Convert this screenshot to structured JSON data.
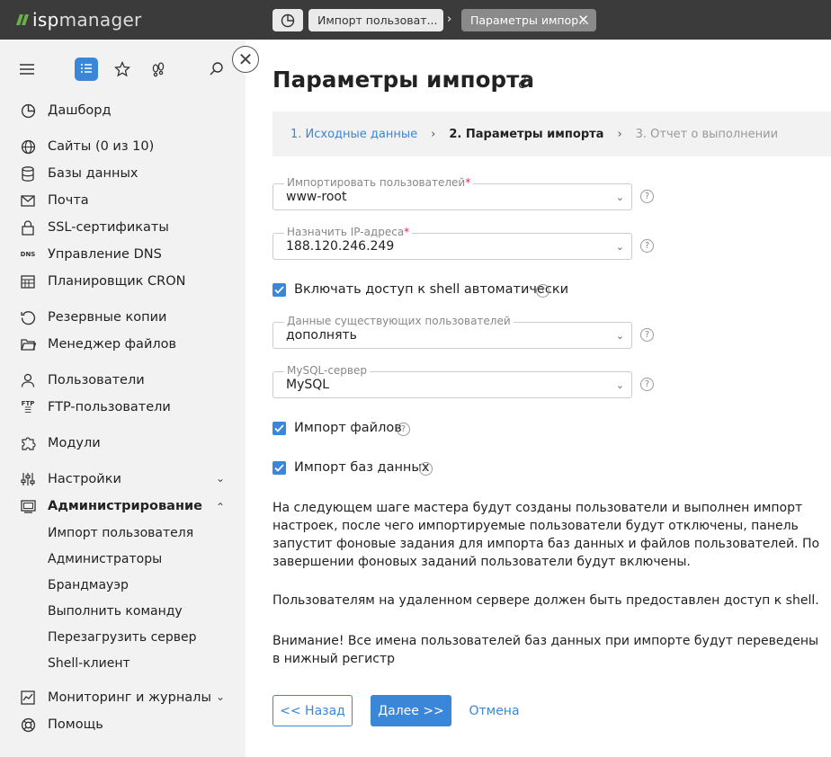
{
  "app": {
    "logo_prefix": "isp",
    "logo_suffix": "manager"
  },
  "tabs": [
    {
      "label": "Импорт пользоват..."
    },
    {
      "label": "Параметры импор..."
    }
  ],
  "sidebar": {
    "items": [
      {
        "label": "Дашборд",
        "icon": "dashboard-icon"
      },
      {
        "label": "Сайты (0 из 10)",
        "icon": "globe-icon"
      },
      {
        "label": "Базы данных",
        "icon": "database-icon"
      },
      {
        "label": "Почта",
        "icon": "mail-icon"
      },
      {
        "label": "SSL-сертификаты",
        "icon": "lock-icon"
      },
      {
        "label": "Управление DNS",
        "icon": "dns-icon",
        "icon_text": "DNS"
      },
      {
        "label": "Планировщик CRON",
        "icon": "calendar-icon"
      },
      {
        "label": "Резервные копии",
        "icon": "backup-icon"
      },
      {
        "label": "Менеджер файлов",
        "icon": "folder-icon"
      },
      {
        "label": "Пользователи",
        "icon": "user-icon"
      },
      {
        "label": "FTP-пользователи",
        "icon": "ftp-icon",
        "icon_text": "FTP"
      },
      {
        "label": "Модули",
        "icon": "puzzle-icon"
      },
      {
        "label": "Настройки",
        "icon": "sliders-icon"
      },
      {
        "label": "Администрирование",
        "icon": "server-icon"
      },
      {
        "label": "Мониторинг и журналы",
        "icon": "chart-icon"
      },
      {
        "label": "Помощь",
        "icon": "help-buoy-icon"
      }
    ],
    "admin_subitems": [
      "Импорт пользователя",
      "Администраторы",
      "Брандмауэр",
      "Выполнить команду",
      "Перезагрузить сервер",
      "Shell-клиент"
    ]
  },
  "main": {
    "title": "Параметры импорта",
    "steps": [
      "1. Исходные данные",
      "2. Параметры импорта",
      "3. Отчет о выполнении"
    ],
    "fields": {
      "import_users": {
        "label": "Импортировать пользователей",
        "value": "www-root",
        "required": "*"
      },
      "assign_ip": {
        "label": "Назначить IP-адреса",
        "value": "188.120.246.249",
        "required": "*"
      },
      "existing_users": {
        "label": "Данные существующих пользователей",
        "value": "дополнять"
      },
      "mysql_server": {
        "label": "MySQL-сервер",
        "value": "MySQL"
      }
    },
    "checkboxes": {
      "shell_access": {
        "label": "Включать доступ к shell автоматически",
        "checked": true
      },
      "import_files": {
        "label": "Импорт файлов",
        "checked": true
      },
      "import_db": {
        "label": "Импорт баз данных",
        "checked": true
      }
    },
    "help_glyph": "?",
    "paragraphs": [
      "На следующем шаге мастера будут созданы пользователи и выполнен импорт настроек, после чего импортируемые пользователи будут отключены, панель запустит фоновые задания для импорта баз данных и файлов пользователей. По завершении фоновых заданий пользователи будут включены.",
      "Пользователям на удаленном сервере должен быть предоставлен доступ к shell.",
      "Внимание! Все имена пользователей баз данных при импорте будут переведены в нижный регистр"
    ],
    "buttons": {
      "back": "<< Назад",
      "next": "Далее >>",
      "cancel": "Отмена"
    }
  },
  "colors": {
    "accent": "#3a86d8",
    "topbar": "#3b3b3b",
    "sidebar": "#f2f2f2",
    "logo_green": "#6ab04c"
  }
}
